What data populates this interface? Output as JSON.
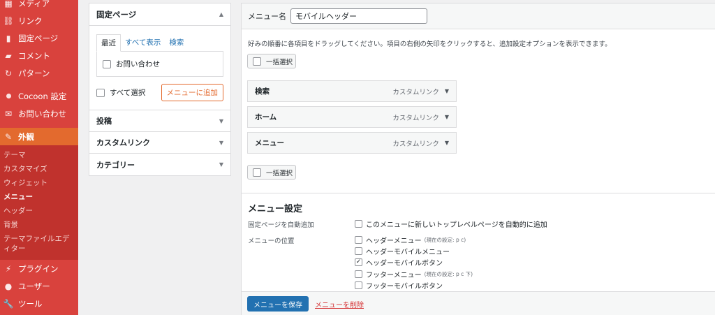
{
  "colors": {
    "sidebar": "#d9423d",
    "sidebar_active": "#e36a2e",
    "primary": "#2271b1",
    "delete": "#d63638"
  },
  "sidebar": {
    "items_top": [
      {
        "label": "メディア",
        "icon": "media-icon",
        "glyph": "▦"
      },
      {
        "label": "リンク",
        "icon": "link-icon",
        "glyph": "🔗"
      },
      {
        "label": "固定ページ",
        "icon": "page-icon",
        "glyph": "▮"
      },
      {
        "label": "コメント",
        "icon": "comment-icon",
        "glyph": "▰"
      },
      {
        "label": "パターン",
        "icon": "pattern-icon",
        "glyph": "↻"
      }
    ],
    "items_mid": [
      {
        "label": "Cocoon 設定",
        "icon": "cocoon-icon"
      },
      {
        "label": "お問い合わせ",
        "icon": "mail-icon",
        "glyph": "✉"
      }
    ],
    "active": {
      "label": "外観",
      "icon": "brush-icon",
      "glyph": "✎"
    },
    "submenu": [
      "テーマ",
      "カスタマイズ",
      "ウィジェット",
      "メニュー",
      "ヘッダー",
      "背景",
      "テーマファイルエディター"
    ],
    "submenu_current": "メニュー",
    "items_bottom": [
      {
        "label": "プラグイン",
        "icon": "plugin-icon",
        "glyph": "⚡"
      },
      {
        "label": "ユーザー",
        "icon": "user-icon",
        "glyph": "●"
      },
      {
        "label": "ツール",
        "icon": "wrench-icon",
        "glyph": "✂"
      }
    ]
  },
  "left_panel": {
    "title": "固定ページ",
    "tabs": [
      "最近",
      "すべて表示",
      "検索"
    ],
    "pages": [
      "お問い合わせ"
    ],
    "select_all": "すべて選択",
    "add_button": "メニューに追加",
    "accordions": [
      "投稿",
      "カスタムリンク",
      "カテゴリー"
    ]
  },
  "menu_editor": {
    "name_label": "メニュー名",
    "name_value": "モバイルヘッダー",
    "instructions": "好みの順番に各項目をドラッグしてください。項目の右側の矢印をクリックすると、追加設定オプションを表示できます。",
    "bulk_select": "一括選択",
    "items": [
      {
        "title": "検索",
        "type": "カスタムリンク"
      },
      {
        "title": "ホーム",
        "type": "カスタムリンク"
      },
      {
        "title": "メニュー",
        "type": "カスタムリンク"
      }
    ],
    "settings_title": "メニュー設定",
    "auto_add_label": "固定ページを自動追加",
    "auto_add_option": "このメニューに新しいトップレベルページを自動的に追加",
    "location_label": "メニューの位置",
    "locations": [
      {
        "label": "ヘッダーメニュー",
        "note": "(現在の設定: p c)",
        "checked": false
      },
      {
        "label": "ヘッダーモバイルメニュー",
        "note": "",
        "checked": false
      },
      {
        "label": "ヘッダーモバイルボタン",
        "note": "",
        "checked": true
      },
      {
        "label": "フッターメニュー",
        "note": "(現在の設定: p c 下)",
        "checked": false
      },
      {
        "label": "フッターモバイルボタン",
        "note": "",
        "checked": false
      }
    ],
    "save_button": "メニューを保存",
    "delete_link": "メニューを削除"
  }
}
